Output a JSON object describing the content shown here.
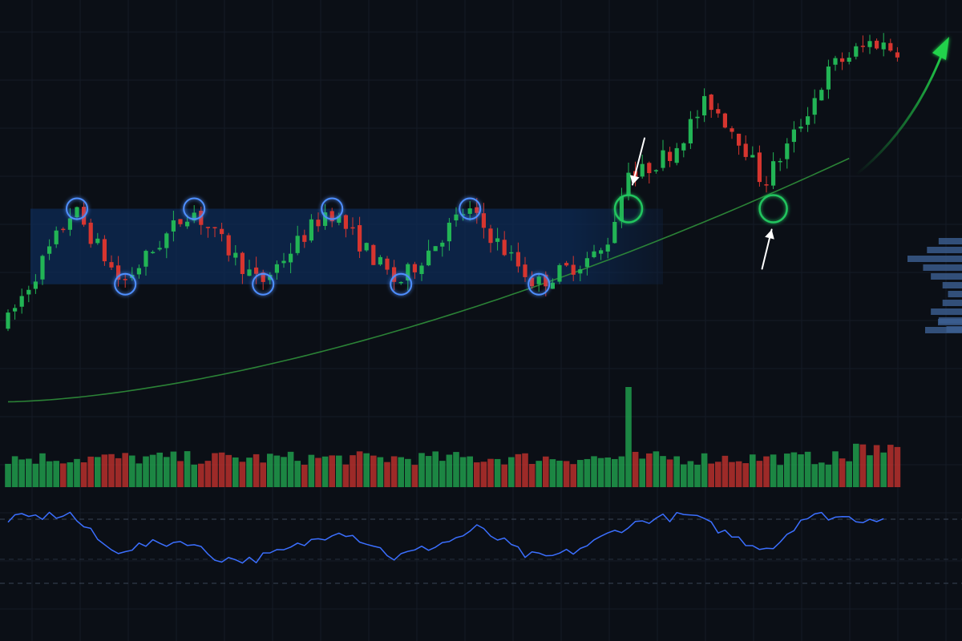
{
  "theme": {
    "background": "#0b0f16",
    "grid": "#141b26",
    "bullish": "#22b455",
    "bearish": "#d6352f",
    "range_fill": "#0d2a55",
    "range_line": "#3d7fff",
    "touch_circle": "#4f8fff",
    "breakout_circle": "#22c55e",
    "moving_average": "#2f8f3a",
    "oscillator": "#3b6fff",
    "arrow_white": "#ffffff",
    "arrow_green": "#22d34b"
  },
  "chart_data": [
    {
      "type": "candlestick",
      "title": "",
      "xlabel": "",
      "ylabel": "",
      "ylim": [
        90,
        132
      ],
      "x_count": 130,
      "grid": true,
      "anchors": [
        [
          0,
          96
        ],
        [
          10,
          110
        ],
        [
          17,
          101
        ],
        [
          27,
          110
        ],
        [
          37,
          101
        ],
        [
          47,
          110
        ],
        [
          57,
          101
        ],
        [
          67,
          110
        ],
        [
          77,
          101
        ],
        [
          87,
          105
        ],
        [
          90,
          113
        ],
        [
          97,
          117
        ],
        [
          102,
          123
        ],
        [
          107,
          118
        ],
        [
          110,
          113
        ],
        [
          114,
          118
        ],
        [
          120,
          127
        ],
        [
          126,
          130
        ],
        [
          129,
          129
        ]
      ],
      "support_level": 101,
      "resistance_level": 110,
      "range_x": [
        5,
        95
      ],
      "resistance_touches_x": [
        10,
        27,
        47,
        67
      ],
      "support_touches_x": [
        17,
        37,
        57,
        77
      ],
      "breakout_x": 90,
      "retest_x": 111,
      "moving_average": {
        "start": 87,
        "end": 116
      },
      "annotations": [
        "breakout-arrow",
        "retest-arrow",
        "trend-arrow"
      ]
    },
    {
      "type": "bar",
      "title": "",
      "series_label": "volume",
      "ylim": [
        0,
        100
      ],
      "typical": 22,
      "spike_x": 90,
      "spike_value": 100
    },
    {
      "type": "line",
      "title": "",
      "series_label": "oscillator",
      "ylim": [
        0,
        100
      ],
      "upper_band": 70,
      "lower_band": 20,
      "anchors": [
        [
          0,
          70
        ],
        [
          9,
          74
        ],
        [
          15,
          45
        ],
        [
          20,
          50
        ],
        [
          26,
          53
        ],
        [
          30,
          40
        ],
        [
          35,
          38
        ],
        [
          40,
          45
        ],
        [
          45,
          55
        ],
        [
          48,
          62
        ],
        [
          53,
          50
        ],
        [
          56,
          40
        ],
        [
          61,
          48
        ],
        [
          65,
          55
        ],
        [
          68,
          63
        ],
        [
          72,
          52
        ],
        [
          75,
          42
        ],
        [
          78,
          40
        ],
        [
          82,
          45
        ],
        [
          85,
          52
        ],
        [
          87,
          58
        ],
        [
          89,
          63
        ],
        [
          93,
          70
        ],
        [
          99,
          73
        ],
        [
          105,
          57
        ],
        [
          108,
          50
        ],
        [
          111,
          48
        ],
        [
          115,
          70
        ],
        [
          118,
          73
        ],
        [
          124,
          70
        ],
        [
          127,
          72
        ]
      ]
    }
  ],
  "side_histogram": {
    "values": [
      30,
      45,
      70,
      50,
      40,
      25,
      18,
      25,
      40,
      30,
      20
    ]
  }
}
